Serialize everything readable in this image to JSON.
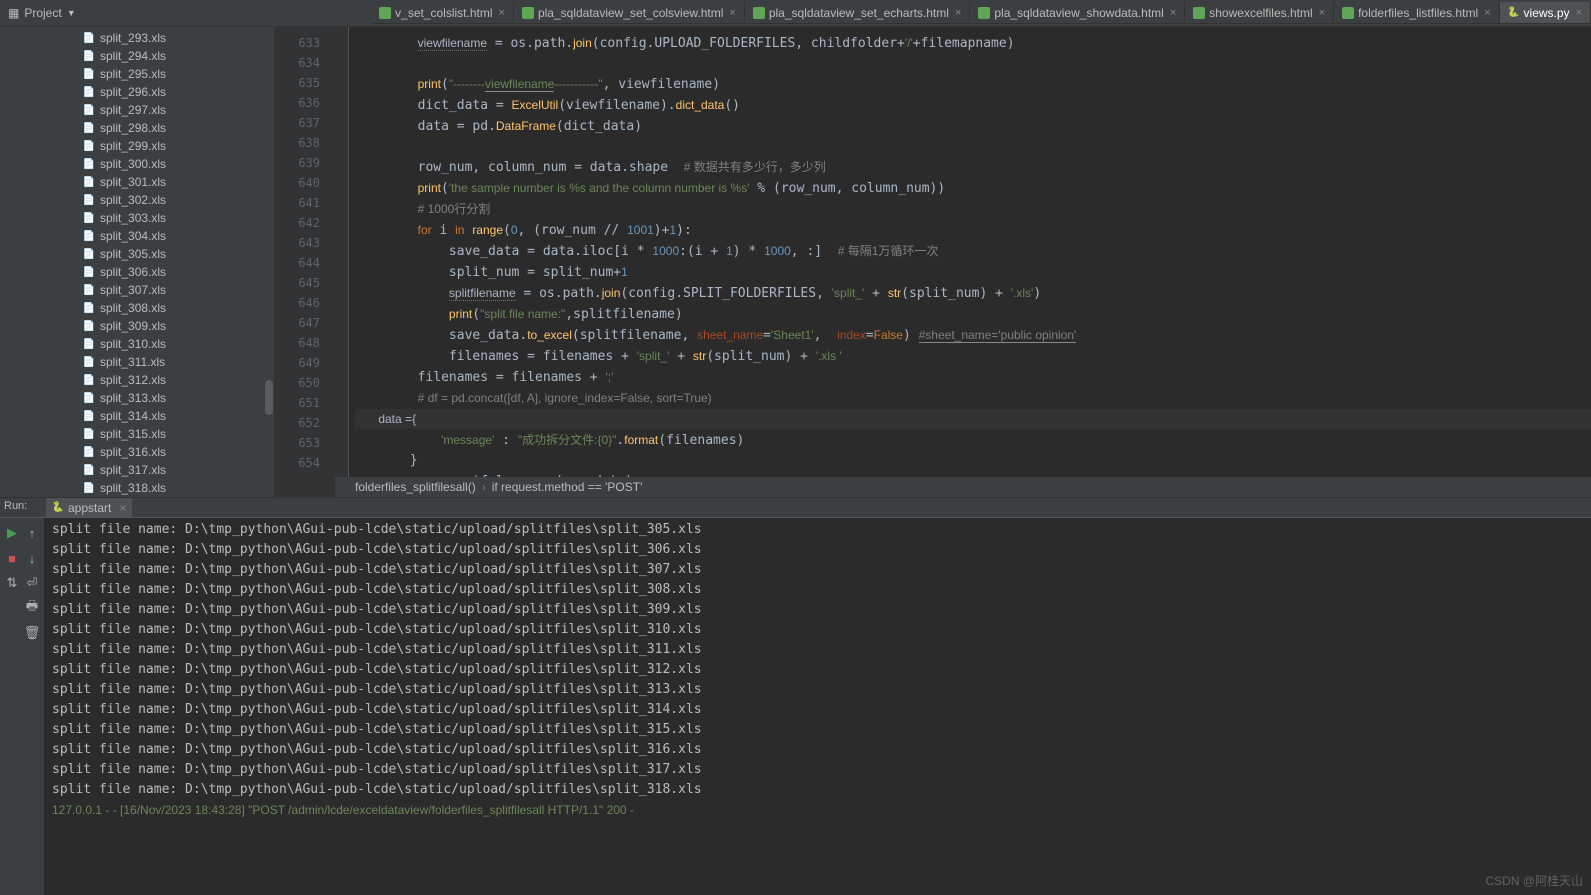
{
  "topbar": {
    "project_label": "Project"
  },
  "tabs": [
    {
      "label": "v_set_colslist.html"
    },
    {
      "label": "pla_sqldataview_set_colsview.html"
    },
    {
      "label": "pla_sqldataview_set_echarts.html"
    },
    {
      "label": "pla_sqldataview_showdata.html"
    },
    {
      "label": "showexcelfiles.html"
    },
    {
      "label": "folderfiles_listfiles.html"
    },
    {
      "label": "views.py",
      "active": true
    }
  ],
  "files": [
    "split_293.xls",
    "split_294.xls",
    "split_295.xls",
    "split_296.xls",
    "split_297.xls",
    "split_298.xls",
    "split_299.xls",
    "split_300.xls",
    "split_301.xls",
    "split_302.xls",
    "split_303.xls",
    "split_304.xls",
    "split_305.xls",
    "split_306.xls",
    "split_307.xls",
    "split_308.xls",
    "split_309.xls",
    "split_310.xls",
    "split_311.xls",
    "split_312.xls",
    "split_313.xls",
    "split_314.xls",
    "split_315.xls",
    "split_316.xls",
    "split_317.xls",
    "split_318.xls"
  ],
  "gutter": {
    "start": 633,
    "end": 654
  },
  "breadcrumb": {
    "fn": "folderfiles_splitfilesall()",
    "cond": "if request.method == 'POST'"
  },
  "run": {
    "label": "Run:",
    "tab": "appstart"
  },
  "terminal": {
    "lines": [
      "split file name: D:\\tmp_python\\AGui-pub-lcde\\static/upload/splitfiles\\split_305.xls",
      "split file name: D:\\tmp_python\\AGui-pub-lcde\\static/upload/splitfiles\\split_306.xls",
      "split file name: D:\\tmp_python\\AGui-pub-lcde\\static/upload/splitfiles\\split_307.xls",
      "split file name: D:\\tmp_python\\AGui-pub-lcde\\static/upload/splitfiles\\split_308.xls",
      "split file name: D:\\tmp_python\\AGui-pub-lcde\\static/upload/splitfiles\\split_309.xls",
      "split file name: D:\\tmp_python\\AGui-pub-lcde\\static/upload/splitfiles\\split_310.xls",
      "split file name: D:\\tmp_python\\AGui-pub-lcde\\static/upload/splitfiles\\split_311.xls",
      "split file name: D:\\tmp_python\\AGui-pub-lcde\\static/upload/splitfiles\\split_312.xls",
      "split file name: D:\\tmp_python\\AGui-pub-lcde\\static/upload/splitfiles\\split_313.xls",
      "split file name: D:\\tmp_python\\AGui-pub-lcde\\static/upload/splitfiles\\split_314.xls",
      "split file name: D:\\tmp_python\\AGui-pub-lcde\\static/upload/splitfiles\\split_315.xls",
      "split file name: D:\\tmp_python\\AGui-pub-lcde\\static/upload/splitfiles\\split_316.xls",
      "split file name: D:\\tmp_python\\AGui-pub-lcde\\static/upload/splitfiles\\split_317.xls",
      "split file name: D:\\tmp_python\\AGui-pub-lcde\\static/upload/splitfiles\\split_318.xls"
    ],
    "last": "127.0.0.1 - - [16/Nov/2023 18:43:28] \"POST /admin/lcde/exceldataview/folderfiles_splitfilesall HTTP/1.1\" 200 -"
  },
  "watermark": "CSDN @阿桂天山"
}
